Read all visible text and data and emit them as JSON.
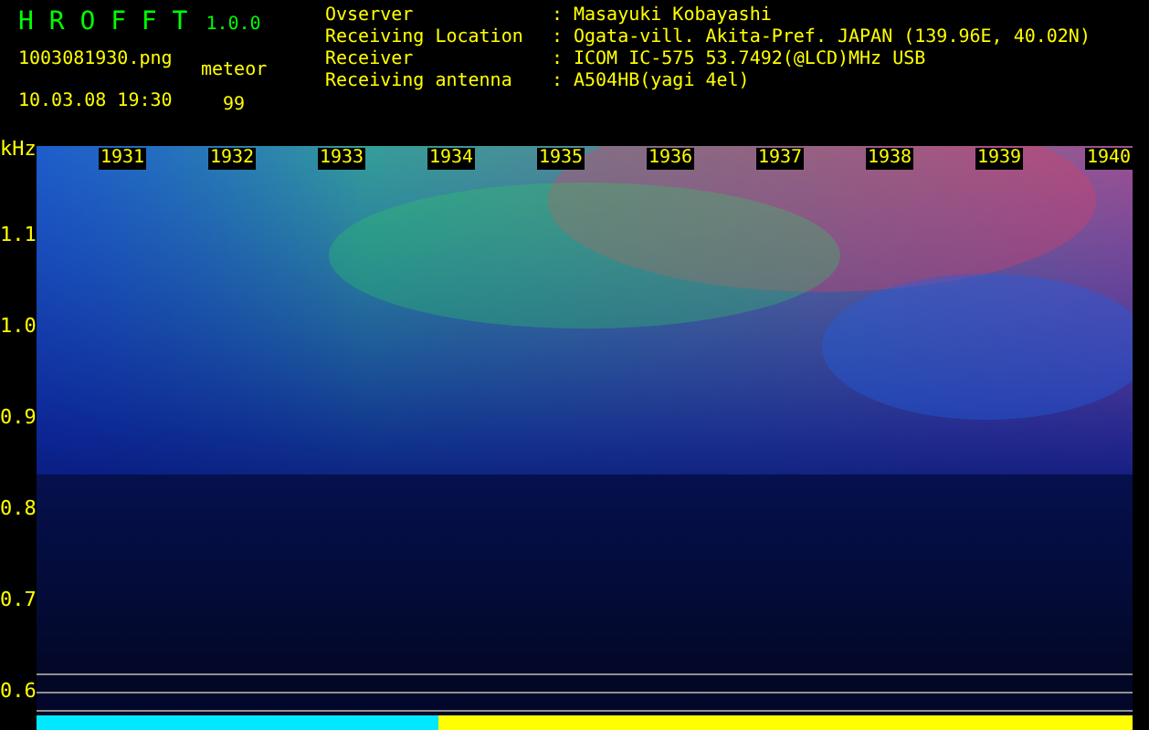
{
  "app": {
    "name": "H R O F F T",
    "version": "1.0.0"
  },
  "file": {
    "name": "1003081930.png",
    "datetime": "10.03.08 19:30"
  },
  "counter": {
    "label": "meteor",
    "value": "99"
  },
  "separator": ":",
  "info": [
    {
      "label": "Ovserver",
      "value": "Masayuki Kobayashi"
    },
    {
      "label": "Receiving Location",
      "value": "Ogata-vill. Akita-Pref. JAPAN (139.96E, 40.02N)"
    },
    {
      "label": "Receiver",
      "value": "ICOM IC-575 53.7492(@LCD)MHz USB"
    },
    {
      "label": "Receiving antenna",
      "value": "A504HB(yagi 4el)"
    }
  ],
  "spectrogram": {
    "unit": "kHz",
    "time_labels": [
      "1931",
      "1932",
      "1933",
      "1934",
      "1935",
      "1936",
      "1937",
      "1938",
      "1939",
      "1940"
    ],
    "freq_labels": [
      "1.1",
      "1.0",
      "0.9",
      "0.8",
      "0.7",
      "0.6"
    ]
  }
}
